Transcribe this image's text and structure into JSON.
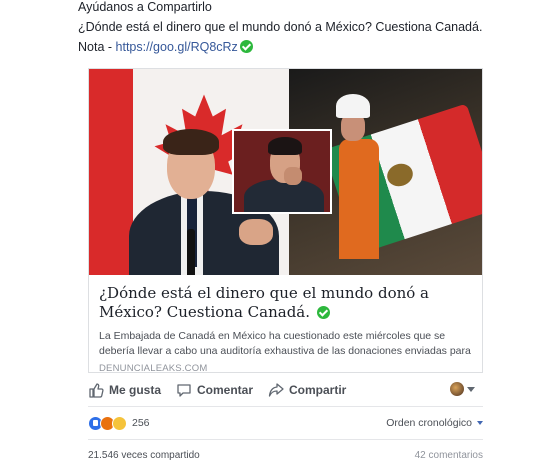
{
  "post": {
    "line1": "Ayúdanos a Compartirlo",
    "line2": "¿Dónde está el dinero que el mundo donó a México? Cuestiona Canadá.",
    "note_prefix": "Nota - ",
    "note_link": "https://goo.gl/RQ8cRz"
  },
  "card": {
    "title": "¿Dónde está el dinero que el mundo donó a México? Cuestiona Canadá.",
    "description": "La Embajada de Canadá en México ha cuestionado este miércoles que se debería llevar a cabo una auditoría exhaustiva de las donaciones enviadas para los...",
    "domain": "DENUNCIALEAKS.COM"
  },
  "actions": {
    "like": "Me gusta",
    "comment": "Comentar",
    "share": "Compartir"
  },
  "reactions": {
    "icons": [
      "like-reaction",
      "angry-reaction",
      "sad-reaction"
    ],
    "count": "256",
    "order_label": "Orden cronológico"
  },
  "stats": {
    "shares": "21.546 veces compartido",
    "comments": "42 comentarios"
  },
  "colors": {
    "link": "#365899",
    "verified": "#2db83d",
    "like_blue": "#2e6fe8"
  }
}
